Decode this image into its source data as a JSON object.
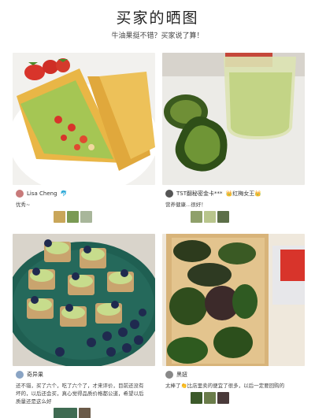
{
  "page": {
    "title": "买家的晒图",
    "subtitle": "牛油果挺不错？买家说了算！"
  },
  "reviews": [
    {
      "user": "Lisa Cheng",
      "badge": "🐬",
      "comment": [
        "优秀~"
      ],
      "thumb_count": 3
    },
    {
      "user": "TST翻秘密金卡***",
      "badge": "👑红梅女王👑",
      "comment": [
        "营养健康...很好！"
      ],
      "thumb_count": 3
    },
    {
      "user": "奇异果",
      "badge": "",
      "comment": [
        "还不错，买了六个，吃了六个了，才来评价，目前还没有",
        "坏的，以后还会买，真心觉得品质价格都公道，希望以后",
        "质量还是这么好"
      ],
      "thumb_count": 2
    },
    {
      "user": "黑妞",
      "badge": "",
      "comment": [
        "太棒了👏比店里卖的便宜了很多，以后一定要回购的"
      ],
      "thumb_count": 3
    }
  ],
  "colors": {
    "avocado": "#3e5a1f",
    "guac": "#a9c85a",
    "bread": "#e8b846",
    "plate": "#1f5f52",
    "blueberry": "#1f2a4f",
    "strawberry": "#d8342b"
  }
}
